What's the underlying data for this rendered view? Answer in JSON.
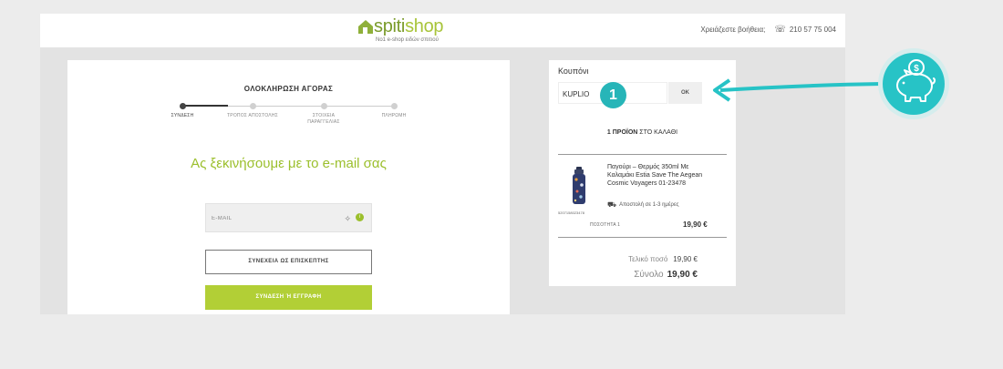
{
  "header": {
    "logo_part1": "spiti",
    "logo_part2": "shop",
    "logo_tagline": "Νο1 e-shop ειδών σπιτιού",
    "help_label": "Χρειάζεστε βοήθεια;",
    "phone": "210 57 75 004",
    "phone_icon": "phone-icon"
  },
  "checkout": {
    "title": "ΟΛΟΚΛΗΡΩΣΗ ΑΓΟΡΑΣ",
    "steps": [
      {
        "label": "ΣΥΝΔΕΣΗ",
        "active": true
      },
      {
        "label": "ΤΡΟΠΟΣ ΑΠΟΣΤΟΛΗΣ",
        "active": false
      },
      {
        "label": "ΣΤΟΙΧΕΙΑ ΠΑΡΑΓΓΕΛΙΑΣ",
        "active": false
      },
      {
        "label": "ΠΛΗΡΩΜΗ",
        "active": false
      }
    ],
    "heading": "Ας ξεκινήσουμε με το e-mail σας",
    "email_placeholder": "E-MAIL",
    "guest_button": "ΣΥΝΕΧΕΙΑ ΩΣ ΕΠΙΣΚΕΠΤΗΣ",
    "login_button": "ΣΥΝΔΕΣΗ Ή ΕΓΓΡΑΦΗ"
  },
  "cart": {
    "coupon_label": "Κουπόνι",
    "coupon_value": "KUPLIO",
    "coupon_button": "OK",
    "badge": "1",
    "count_bold": "1 ΠΡΟΪΟΝ",
    "count_rest": "ΣΤΟ ΚΑΛΑΘΙ",
    "product": {
      "name": "Παγούρι – Θερμός 350ml Με Καλαμάκι Estia Save The Aegean Cosmic Voyagers 01-23478",
      "sku": "5207158023478",
      "shipping": "Αποστολή σε 1-3 ημέρες",
      "quantity_label": "ΠΟΣΟΤΗΤΑ 1",
      "price": "19,90 €"
    },
    "total_label": "Τελικό ποσό",
    "total_value": "19,90 €",
    "sum_label": "Σύνολο",
    "sum_value": "19,90 €"
  },
  "colors": {
    "accent_green": "#b2cf36",
    "teal": "#27b5b8"
  }
}
